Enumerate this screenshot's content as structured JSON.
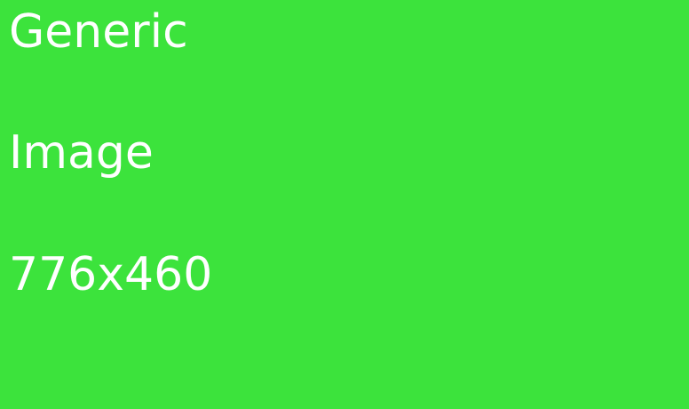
{
  "image": {
    "background_color": "#3ce33c",
    "text_color": "#ffffff",
    "lines": [
      "Generic",
      "Image",
      "776x460"
    ]
  }
}
